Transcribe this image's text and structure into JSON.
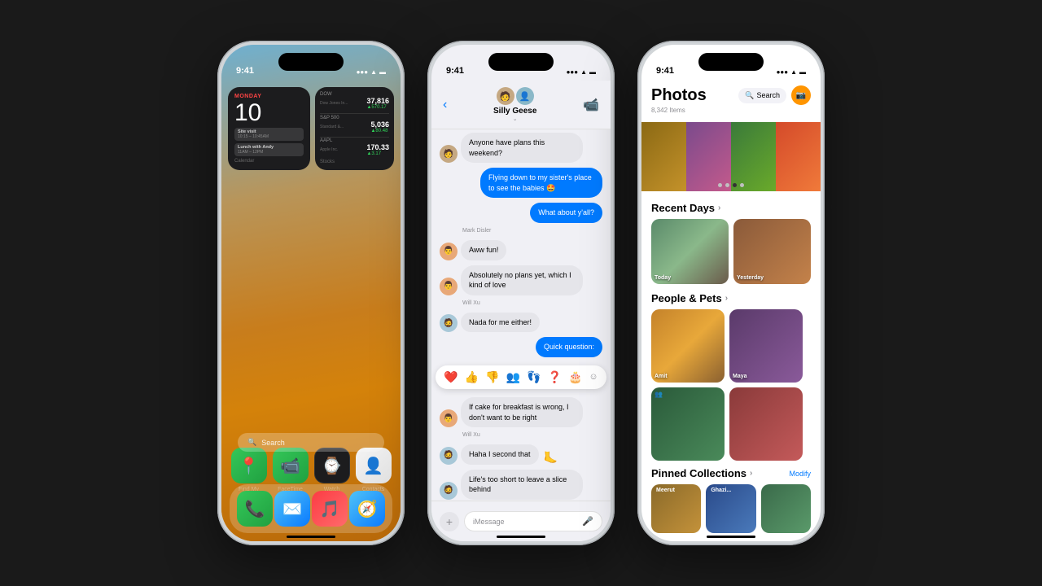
{
  "phones": {
    "phone1": {
      "statusBar": {
        "time": "9:41",
        "signal": "▌▌▌",
        "wifi": "WiFi",
        "battery": "🔋"
      },
      "widgets": {
        "calendar": {
          "dayLabel": "MONDAY",
          "date": "10",
          "events": [
            {
              "title": "Site visit",
              "time": "10:15 – 10:45AM"
            },
            {
              "title": "Lunch with Andy",
              "time": "11AM – 12PM"
            }
          ]
        },
        "stocks": {
          "items": [
            {
              "symbol": "DOW",
              "description": "Dow Jones In...",
              "price": "37,816",
              "change": "▲570.17"
            },
            {
              "symbol": "S&P 500",
              "description": "Standard &...",
              "price": "5,036",
              "change": "▲80.48"
            },
            {
              "symbol": "AAPL",
              "description": "Apple Inc.",
              "price": "170.33",
              "change": "▲3.17"
            }
          ]
        },
        "label": {
          "calendar": "Calendar",
          "stocks": "Stocks"
        }
      },
      "apps": [
        {
          "name": "Find My",
          "icon": "📍",
          "color": "#34c759"
        },
        {
          "name": "FaceTime",
          "icon": "📹",
          "color": "#34c759"
        },
        {
          "name": "Watch",
          "icon": "⌚",
          "color": "#1c1c1e"
        },
        {
          "name": "Contacts",
          "icon": "👤",
          "color": "#ff9500"
        }
      ],
      "searchLabel": "Search",
      "dock": [
        {
          "name": "Phone",
          "icon": "📞",
          "color": "#34c759"
        },
        {
          "name": "Mail",
          "icon": "✉️",
          "color": "#0a7aff"
        },
        {
          "name": "Music",
          "icon": "🎵",
          "color": "#fc3c44"
        },
        {
          "name": "Safari",
          "icon": "🧭",
          "color": "#0a7aff"
        }
      ]
    },
    "phone2": {
      "statusBar": {
        "time": "9:41",
        "signal": "▌▌▌",
        "wifi": "WiFi",
        "battery": "🔋"
      },
      "header": {
        "groupName": "Silly Geese",
        "chevron": "⌄"
      },
      "messages": [
        {
          "type": "incoming",
          "avatar": "🧑",
          "text": "Anyone have plans this weekend?",
          "sender": ""
        },
        {
          "type": "outgoing",
          "text": "Flying down to my sister's place to see the babies 🤩"
        },
        {
          "type": "outgoing",
          "text": "What about y'all?"
        },
        {
          "type": "sender_label",
          "text": "Mark Disler"
        },
        {
          "type": "incoming",
          "avatar": "👨",
          "text": "Aww fun!"
        },
        {
          "type": "incoming",
          "avatar": "👨",
          "text": "Absolutely no plans yet, which I kind of love"
        },
        {
          "type": "sender_label",
          "text": "Will Xu"
        },
        {
          "type": "incoming",
          "avatar": "🧔",
          "text": "Nada for me either!"
        },
        {
          "type": "outgoing",
          "text": "Quick question:"
        },
        {
          "type": "tapback",
          "emojis": [
            "❤️",
            "👍",
            "👎",
            "👥",
            "👣",
            "❓",
            "🎂"
          ]
        },
        {
          "type": "incoming",
          "avatar": "👨",
          "text": "If cake for breakfast is wrong, I don't want to be right"
        },
        {
          "type": "sender_label",
          "text": "Will Xu"
        },
        {
          "type": "incoming",
          "avatar": "🧔",
          "text": "Haha I second that"
        },
        {
          "type": "incoming",
          "avatar": "🧔",
          "text": "Life's too short to leave a slice behind"
        }
      ],
      "inputPlaceholder": "iMessage"
    },
    "phone3": {
      "statusBar": {
        "time": "9:41",
        "signal": "▌▌▌",
        "wifi": "WiFi",
        "battery": "🔋"
      },
      "header": {
        "title": "Photos",
        "itemCount": "8,342 Items",
        "searchLabel": "Search"
      },
      "sections": {
        "recentDays": {
          "title": "Recent Days",
          "chevron": "›",
          "days": [
            {
              "label": "Today"
            },
            {
              "label": "Yesterday"
            }
          ]
        },
        "peopleAndPets": {
          "title": "People & Pets",
          "chevron": "›",
          "people": [
            {
              "name": "Amit"
            },
            {
              "name": "Maya"
            }
          ]
        },
        "pinnedCollections": {
          "title": "Pinned Collections",
          "chevron": "›",
          "modifyLabel": "Modify",
          "items": [
            {
              "name": "Meerut"
            },
            {
              "name": "Ghazi..."
            }
          ]
        }
      }
    }
  }
}
